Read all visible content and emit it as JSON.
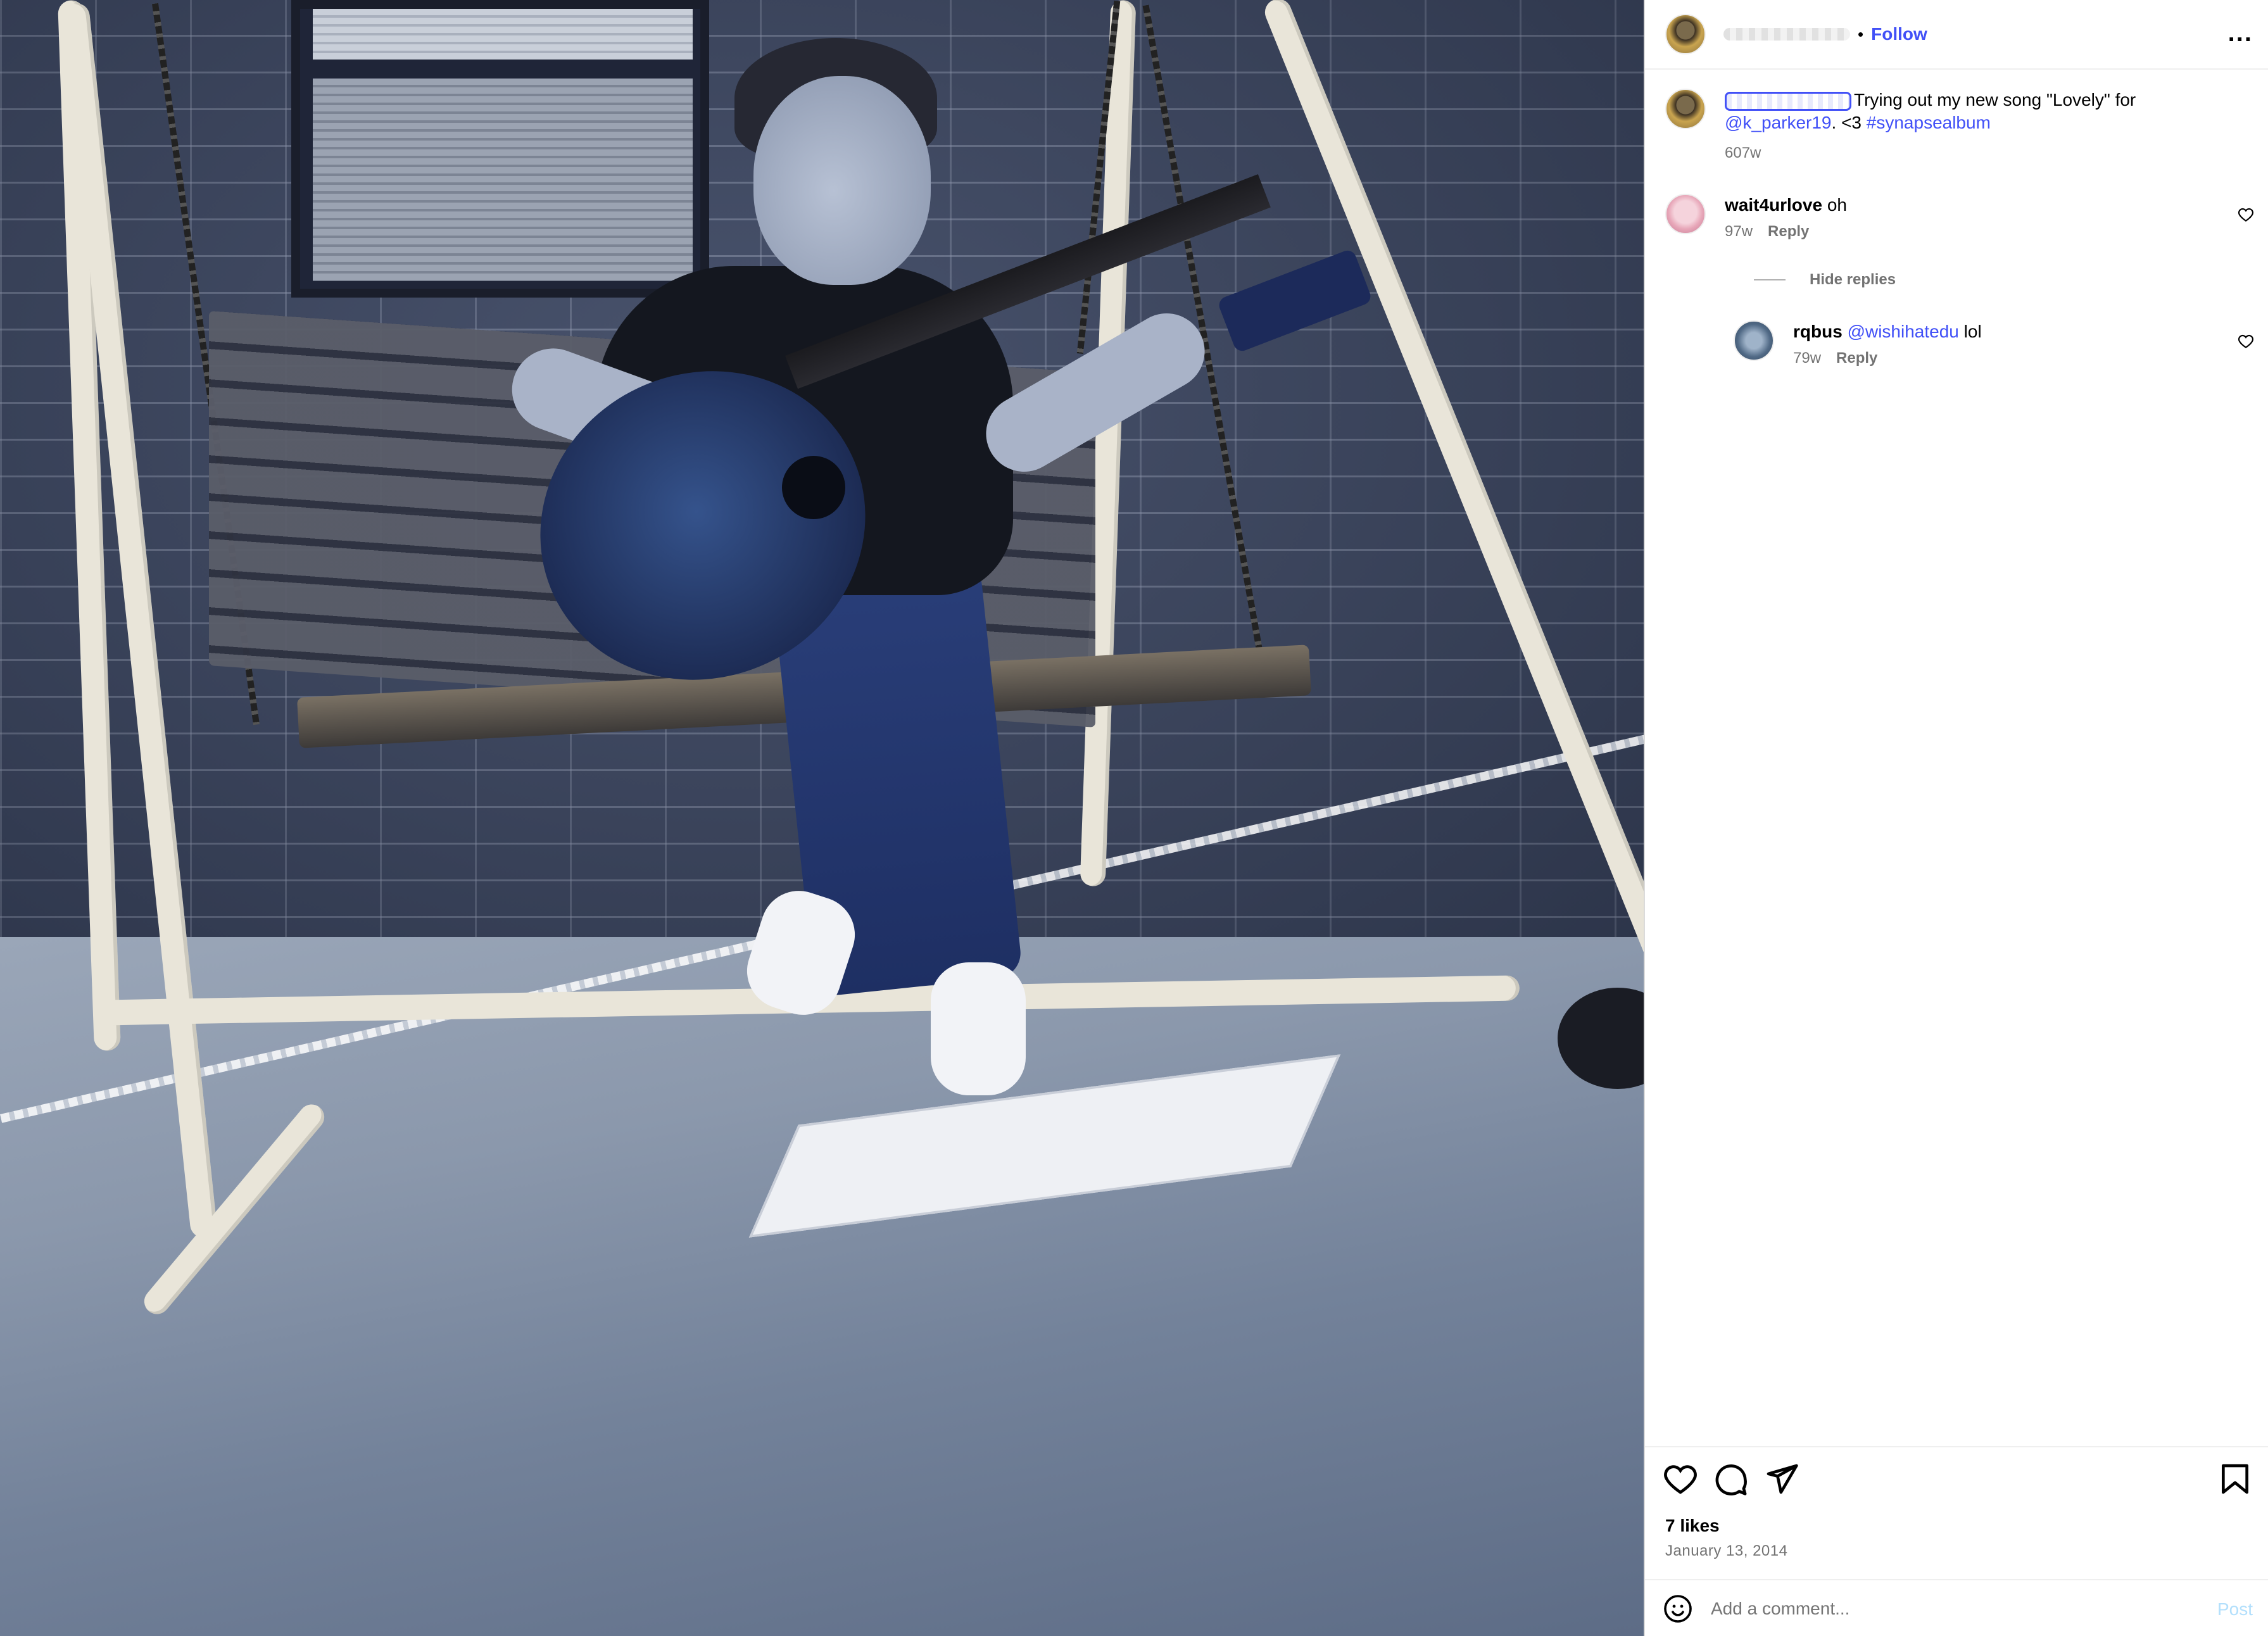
{
  "header": {
    "follow_label": "Follow",
    "separator": "•",
    "more_label": "..."
  },
  "caption": {
    "text": "Trying out my new song \"Lovely\" for",
    "mention": "@k_parker19",
    "after_mention": ". <3 ",
    "hashtag": "#synapsealbum",
    "age": "607w"
  },
  "comments": [
    {
      "username": "wait4urlove",
      "text": "oh",
      "age": "97w",
      "reply_label": "Reply"
    },
    {
      "username": "rqbus",
      "mention": "@wishihatedu",
      "text": "lol",
      "age": "79w",
      "reply_label": "Reply"
    }
  ],
  "hide_replies_label": "Hide replies",
  "actions": {
    "icons": [
      "heart-icon",
      "comment-icon",
      "share-icon",
      "bookmark-icon"
    ],
    "likes": "7 likes",
    "date": "January 13, 2014"
  },
  "comment_box": {
    "placeholder": "Add a comment...",
    "post_label": "Post",
    "emoji_icon": "emoji-icon"
  },
  "colors": {
    "link": "#4150f7",
    "muted": "#737373",
    "post_disabled": "#b2dffc"
  }
}
